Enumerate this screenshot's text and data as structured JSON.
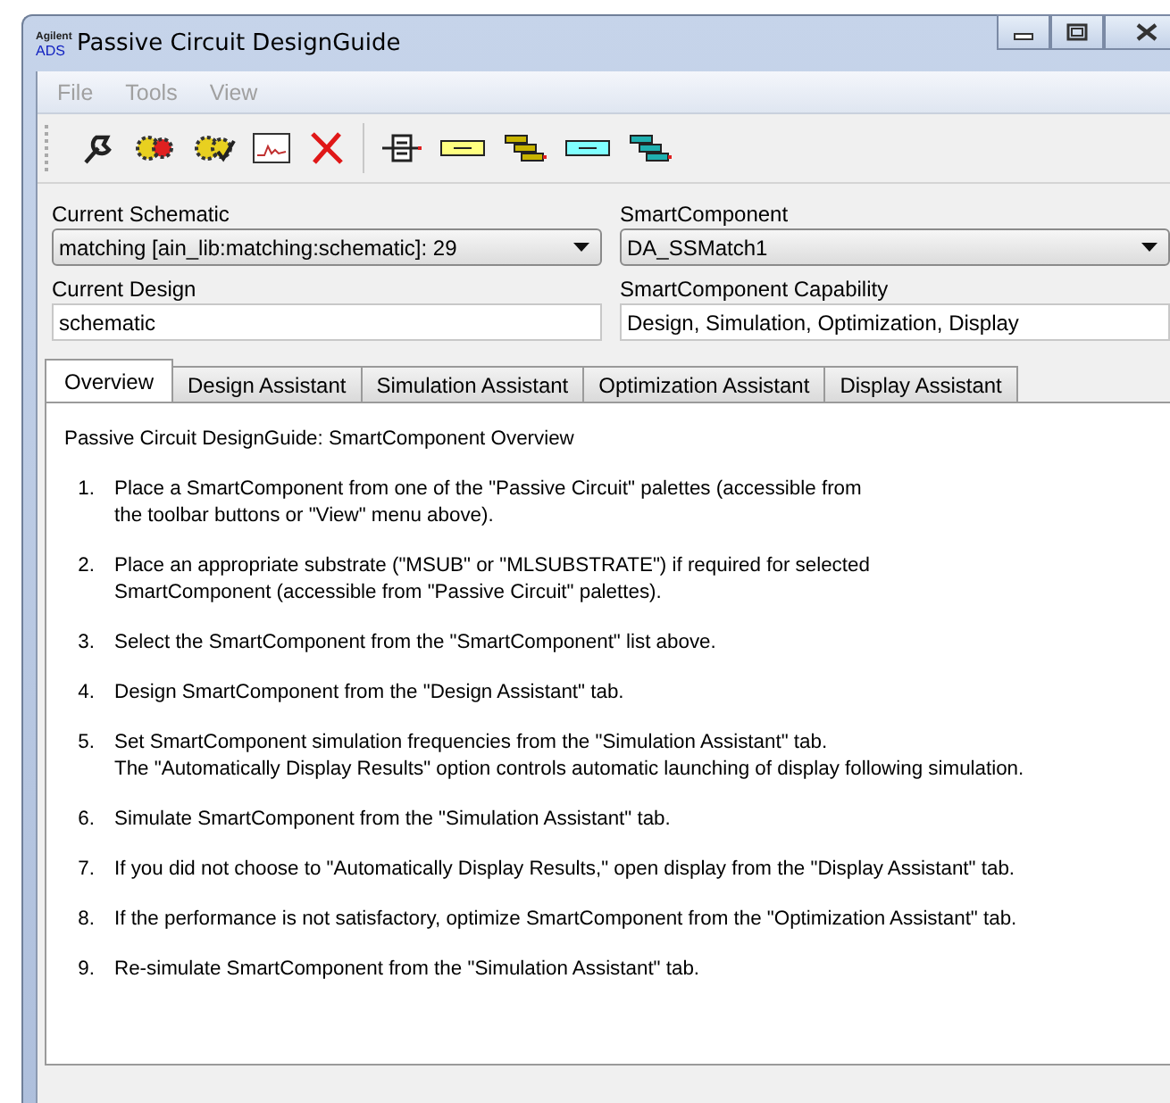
{
  "window": {
    "title": "Passive Circuit DesignGuide",
    "logo": "Agilent ADS"
  },
  "menu": [
    {
      "label": "File",
      "disabled": true
    },
    {
      "label": "Tools",
      "disabled": true
    },
    {
      "label": "View",
      "disabled": true
    }
  ],
  "toolbar": [
    {
      "kind": "wrench"
    },
    {
      "kind": "gear"
    },
    {
      "kind": "gear-check"
    },
    {
      "kind": "chart"
    },
    {
      "kind": "delete"
    },
    {
      "kind": "separator"
    },
    {
      "kind": "component"
    },
    {
      "kind": "yellow-line"
    },
    {
      "kind": "yellow-steps"
    },
    {
      "kind": "cyan-line"
    },
    {
      "kind": "cyan-steps"
    }
  ],
  "current_schematic": {
    "label": "Current Schematic",
    "value": "matching [ain_lib:matching:schematic]: 29"
  },
  "smart_component": {
    "label": "SmartComponent",
    "value": "DA_SSMatch1"
  },
  "current_design": {
    "label": "Current Design",
    "value": "schematic"
  },
  "capability": {
    "label": "SmartComponent Capability",
    "value": "Design, Simulation, Optimization, Display"
  },
  "tabs": [
    {
      "label": "Overview",
      "selected": true
    },
    {
      "label": "Design Assistant",
      "selected": false
    },
    {
      "label": "Simulation Assistant",
      "selected": false
    },
    {
      "label": "Optimization Assistant",
      "selected": false
    },
    {
      "label": "Display Assistant",
      "selected": false
    }
  ],
  "overview": {
    "heading": "Passive Circuit DesignGuide: SmartComponent Overview",
    "steps": [
      {
        "number": "1.",
        "lines": [
          "Place a SmartComponent from one of the \"Passive Circuit\" palettes (accessible from",
          "the toolbar buttons or \"View\" menu above)."
        ]
      },
      {
        "number": "2.",
        "lines": [
          "Place an appropriate substrate (\"MSUB\" or \"MLSUBSTRATE\") if required for selected",
          "SmartComponent (accessible from \"Passive Circuit\" palettes)."
        ]
      },
      {
        "number": "3.",
        "lines": [
          "Select the SmartComponent from the \"SmartComponent\" list above."
        ]
      },
      {
        "number": "4.",
        "lines": [
          "Design SmartComponent from the \"Design Assistant\" tab."
        ]
      },
      {
        "number": "5.",
        "lines": [
          "Set SmartComponent simulation frequencies from the \"Simulation Assistant\" tab.",
          "The \"Automatically Display Results\" option controls automatic launching of display following simulation."
        ]
      },
      {
        "number": "6.",
        "lines": [
          "Simulate SmartComponent from the \"Simulation Assistant\" tab."
        ]
      },
      {
        "number": "7.",
        "lines": [
          "If you did not choose to \"Automatically Display Results,\" open display from the \"Display Assistant\" tab."
        ]
      },
      {
        "number": "8.",
        "lines": [
          "If the performance is not satisfactory, optimize SmartComponent from the \"Optimization Assistant\" tab."
        ]
      },
      {
        "number": "9.",
        "lines": [
          "Re-simulate SmartComponent from the \"Simulation Assistant\" tab."
        ]
      }
    ]
  }
}
